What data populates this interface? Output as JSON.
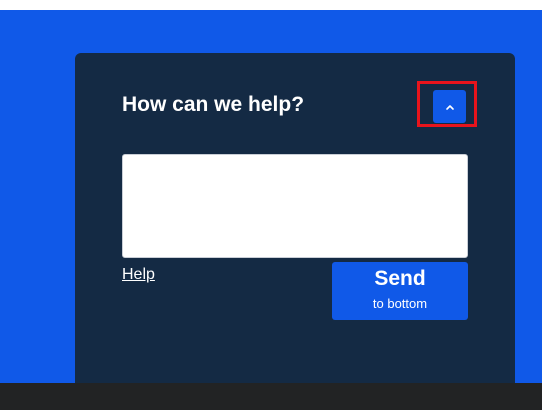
{
  "widget": {
    "title": "How can we help?",
    "message": {
      "value": "",
      "placeholder": ""
    },
    "help_link": "Help",
    "send_button": {
      "label": "Send",
      "sublabel": "to bottom"
    },
    "collapse_icon": "chevron-up-icon"
  },
  "colors": {
    "background": "#1059e8",
    "panel": "#142a44",
    "accent": "#1059e8",
    "highlight": "#e8141c",
    "bottom_bar": "#222324"
  }
}
